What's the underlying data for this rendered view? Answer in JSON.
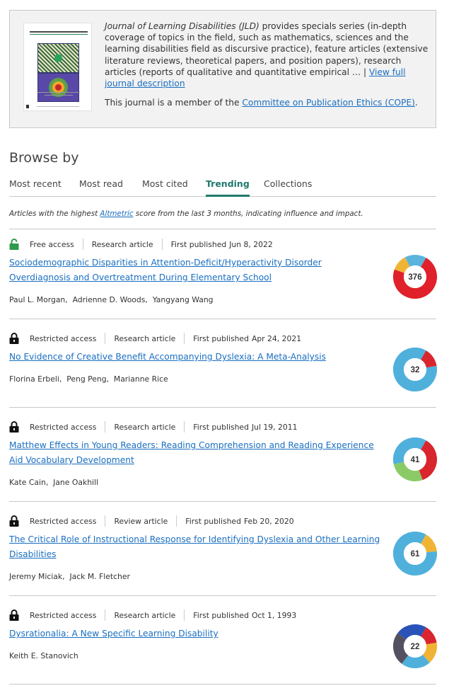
{
  "journal": {
    "cover_alt": "Journal of Learning Disabilities cover",
    "desc_italic": "Journal of Learning Disabilities (JLD)",
    "desc_text": " provides specials series (in-depth coverage of topics in the field, such as mathematics, sciences and the learning disabilities field as discursive practice), feature articles (extensive literature reviews, theoretical papers, and position papers), research articles (reports of qualitative and quantitative empirical … | ",
    "desc_link": "View full journal description",
    "cope_prefix": "This journal is a member of the ",
    "cope_link": "Committee on Publication Ethics (COPE)",
    "cope_suffix": "."
  },
  "browse": {
    "title": "Browse by",
    "tabs": [
      {
        "label": "Most recent",
        "active": false
      },
      {
        "label": "Most read",
        "active": false
      },
      {
        "label": "Most cited",
        "active": false
      },
      {
        "label": "Trending",
        "active": true
      },
      {
        "label": "Collections",
        "active": false
      }
    ],
    "note_prefix": "Articles with the highest ",
    "note_link": "Altmetric",
    "note_suffix": " score from the last 3 months, indicating influence and impact."
  },
  "colors": {
    "link": "#1a6fc1",
    "active_tab": "#1f7a6c",
    "free_lock": "#2e9a4a",
    "restricted_lock": "#111111"
  },
  "articles": [
    {
      "access": "Free access",
      "access_icon": "unlock-icon",
      "type": "Research article",
      "published_label": "First published",
      "date": "Jun 8, 2022",
      "title": "Sociodemographic Disparities in Attention-Deficit/Hyperactivity Disorder Overdiagnosis and Overtreatment During Elementary School",
      "authors": [
        "Paul L. Morgan",
        "Adrienne D. Woods",
        "Yangyang Wang"
      ],
      "altmetric": "376",
      "altmetric_colors": [
        [
          "#e0202a",
          0.72
        ],
        [
          "#f0b435",
          0.12
        ],
        [
          "#5ab4dc",
          0.16
        ]
      ]
    },
    {
      "access": "Restricted access",
      "access_icon": "lock-icon",
      "type": "Research article",
      "published_label": "First published",
      "date": "Apr 24, 2021",
      "title": "No Evidence of Creative Benefit Accompanying Dyslexia: A Meta-Analysis",
      "authors": [
        "Florina Erbeli",
        "Peng Peng",
        "Marianne Rice"
      ],
      "altmetric": "32",
      "altmetric_colors": [
        [
          "#d9262e",
          0.14
        ],
        [
          "#4fb0dc",
          0.86
        ]
      ]
    },
    {
      "access": "Restricted access",
      "access_icon": "lock-icon",
      "type": "Research article",
      "published_label": "First published",
      "date": "Jul 19, 2011",
      "title": "Matthew Effects in Young Readers: Reading Comprehension and Reading Experience Aid Vocabulary Development",
      "authors": [
        "Kate Cain",
        "Jane Oakhill"
      ],
      "altmetric": "41",
      "altmetric_colors": [
        [
          "#d9262e",
          0.36
        ],
        [
          "#8bcb67",
          0.27
        ],
        [
          "#4fb0dc",
          0.37
        ]
      ]
    },
    {
      "access": "Restricted access",
      "access_icon": "lock-icon",
      "type": "Review article",
      "published_label": "First published",
      "date": "Feb 20, 2020",
      "title": "The Critical Role of Instructional Response for Identifying Dyslexia and Other Learning Disabilities",
      "authors": [
        "Jeremy Miciak",
        "Jack M. Fletcher"
      ],
      "altmetric": "61",
      "altmetric_colors": [
        [
          "#f0b435",
          0.15
        ],
        [
          "#4fb0dc",
          0.85
        ]
      ]
    },
    {
      "access": "Restricted access",
      "access_icon": "lock-icon",
      "type": "Research article",
      "published_label": "First published",
      "date": "Oct 1, 1993",
      "title": "Dysrationalia: A New Specific Learning Disability",
      "authors": [
        "Keith E. Stanovich"
      ],
      "altmetric": "22",
      "altmetric_colors": [
        [
          "#d9262e",
          0.14
        ],
        [
          "#f0b435",
          0.16
        ],
        [
          "#4fb0dc",
          0.22
        ],
        [
          "#555060",
          0.25
        ],
        [
          "#2a52b8",
          0.23
        ]
      ]
    }
  ]
}
